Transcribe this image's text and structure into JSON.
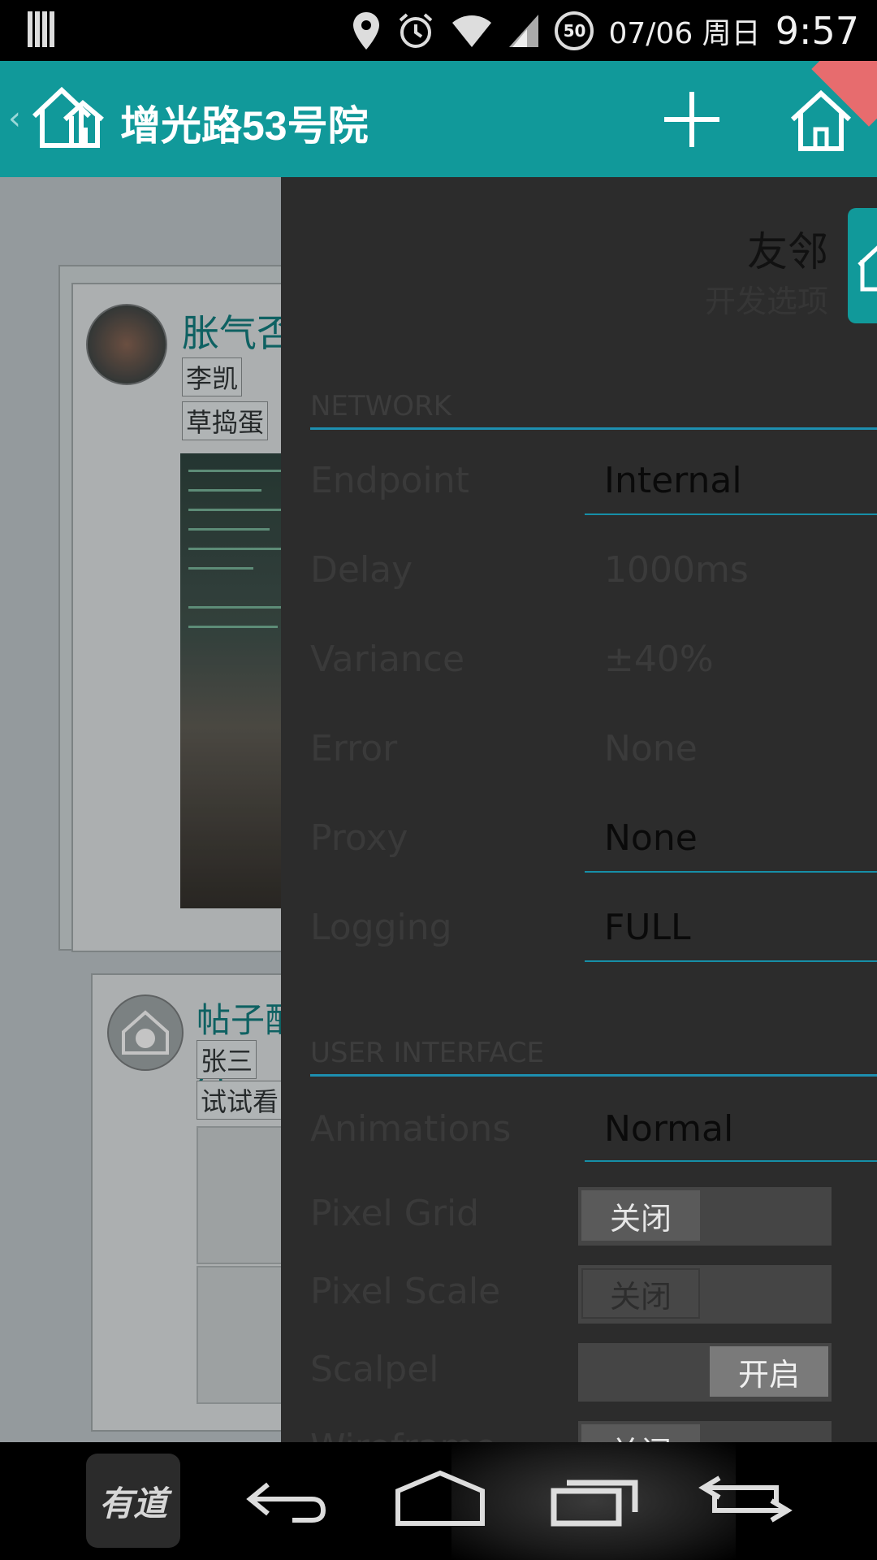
{
  "status_bar": {
    "battery_badge": "50",
    "date": "07/06 周日",
    "time": "9:57",
    "icons": [
      "signal-bars-icon",
      "location-icon",
      "alarm-icon",
      "wifi-icon",
      "cell-signal-icon"
    ]
  },
  "app_bar": {
    "title": "增光路53号院",
    "accent": "#11999a",
    "icons": [
      "back-chevron-icon",
      "home-logo-icon",
      "add-icon",
      "home-icon"
    ]
  },
  "feed": {
    "posts": [
      {
        "title": "胀气否",
        "author": "李凯",
        "body": "草捣蛋"
      },
      {
        "title": "帖子配图片",
        "author": "张三",
        "body": "试试看"
      }
    ]
  },
  "drawer": {
    "app_name": "友邻",
    "subtitle": "开发选项",
    "network_header": "NETWORK",
    "network_rows": [
      {
        "label": "Endpoint",
        "value": "Internal",
        "enabled": true
      },
      {
        "label": "Delay",
        "value": "1000ms",
        "enabled": false
      },
      {
        "label": "Variance",
        "value": "±40%",
        "enabled": false
      },
      {
        "label": "Error",
        "value": "None",
        "enabled": false
      },
      {
        "label": "Proxy",
        "value": "None",
        "enabled": true
      },
      {
        "label": "Logging",
        "value": "FULL",
        "enabled": true
      }
    ],
    "ui_header": "USER INTERFACE",
    "animations": {
      "label": "Animations",
      "value": "Normal"
    },
    "toggles": [
      {
        "label": "Pixel Grid",
        "state": "关闭",
        "on": false,
        "enabled": true
      },
      {
        "label": "Pixel Scale",
        "state": "关闭",
        "on": false,
        "enabled": false
      },
      {
        "label": "Scalpel",
        "state": "开启",
        "on": true,
        "enabled": true
      },
      {
        "label": "Wireframe",
        "state": "关闭",
        "on": false,
        "enabled": true
      }
    ]
  },
  "nav_bar": {
    "youdao_label": "有道",
    "icons": [
      "youdao-icon",
      "back-icon",
      "home-icon",
      "recents-icon",
      "rotate-icon"
    ]
  }
}
